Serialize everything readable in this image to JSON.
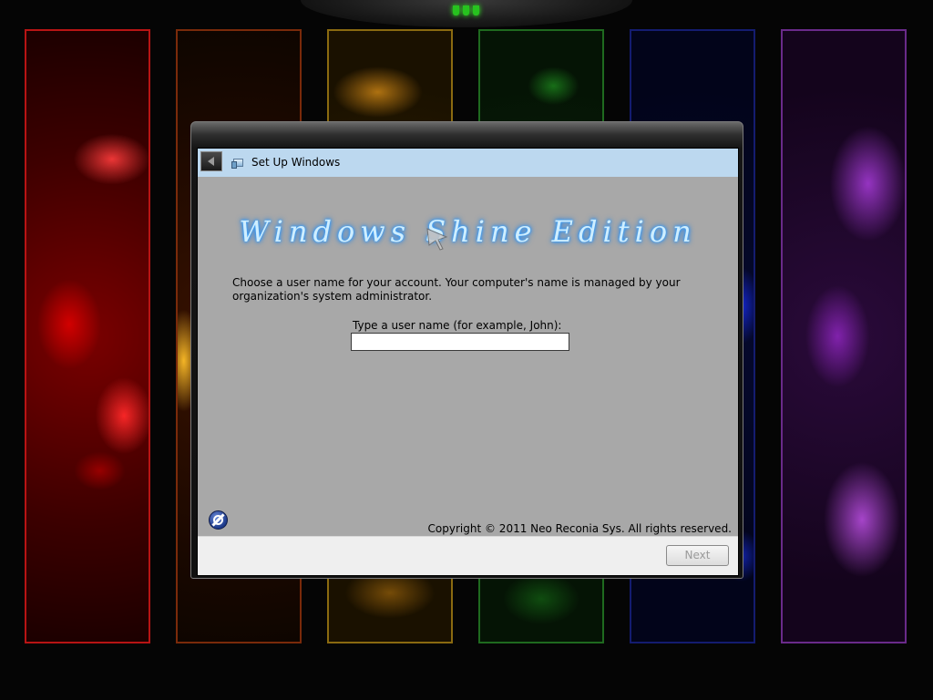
{
  "window": {
    "title": "Set Up Windows"
  },
  "branding": {
    "logo_text": "Windows Shine Edition"
  },
  "main": {
    "description": "Choose a user name for your account.  Your computer's name is managed by your organization's system administrator.",
    "username_label": "Type a user name (for example, John):",
    "username_value": ""
  },
  "footer": {
    "copyright": "Copyright © 2011 Neo Reconia Sys.  All rights reserved.",
    "next_label": "Next",
    "next_enabled": false
  },
  "icons": {
    "back": "back-arrow-icon",
    "setup": "setup-windows-icon",
    "ease_of_access": "ease-of-access-icon",
    "cursor": "mouse-cursor-icon"
  },
  "colors": {
    "header_bar": "#bcd8ef",
    "client_background": "#a8a8a8",
    "logo_glow": "#2a90ff"
  }
}
